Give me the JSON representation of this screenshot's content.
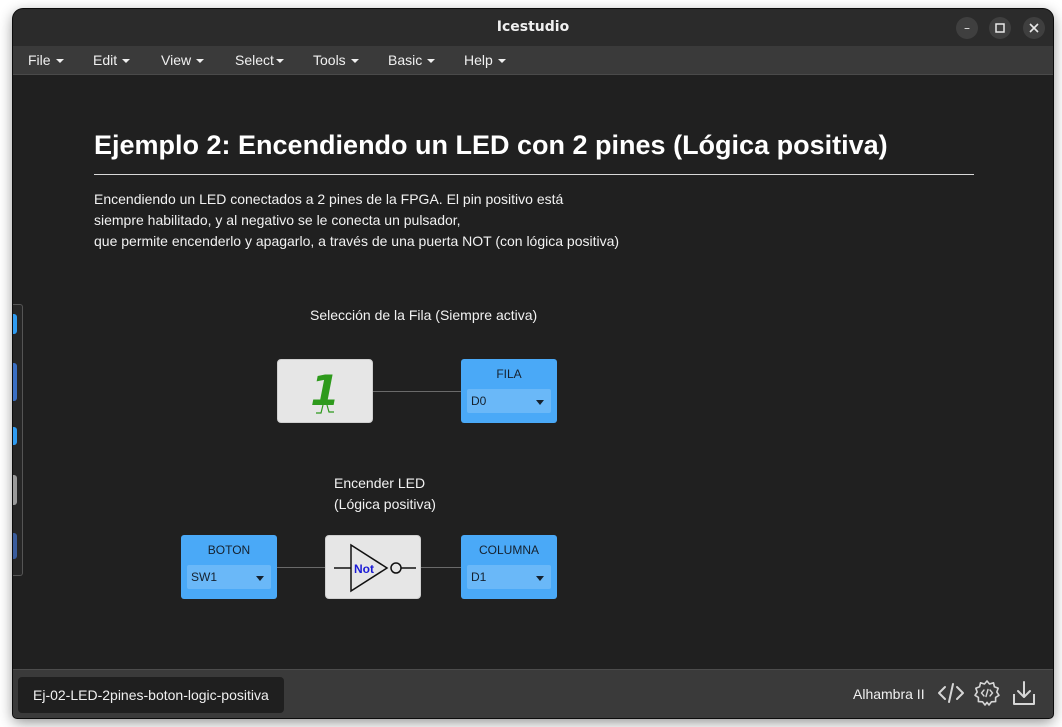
{
  "window": {
    "title": "Icestudio"
  },
  "menu": [
    {
      "label": "File"
    },
    {
      "label": "Edit"
    },
    {
      "label": "View"
    },
    {
      "label": "Select"
    },
    {
      "label": "Tools"
    },
    {
      "label": "Basic"
    },
    {
      "label": "Help"
    }
  ],
  "canvas": {
    "heading": "Ejemplo 2: Encendiendo un LED con 2 pines (Lógica positiva)",
    "description": [
      "Encendiendo un LED conectados a 2 pines de la FPGA. El pin positivo está",
      "siempre habilitado, y al negativo se le conecta un pulsador,",
      "que permite encenderlo y apagarlo, a través de una puerta NOT (con lógica positiva)"
    ],
    "note_fila": "Selección de la Fila (Siempre activa)",
    "note_led": [
      "Encender LED",
      "(Lógica positiva)"
    ],
    "blocks": {
      "const1": {
        "text": "1"
      },
      "fila": {
        "label": "FILA",
        "value": "D0"
      },
      "boton": {
        "label": "BOTON",
        "value": "SW1"
      },
      "not_gate": {
        "label": "Not"
      },
      "columna": {
        "label": "COLUMNA",
        "value": "D1"
      }
    }
  },
  "status": {
    "filename": "Ej-02-LED-2pines-boton-logic-positiva",
    "board": "Alhambra II",
    "icons": [
      "code-icon",
      "gear-code-icon",
      "download-icon"
    ]
  },
  "colors": {
    "io_block": "#4aa9f7",
    "io_select": "#6ab8f8",
    "logic_block": "#e6e6e6",
    "const_green": "#2e9a1c",
    "not_label": "#1a1ad6",
    "canvas_bg": "#202020"
  }
}
